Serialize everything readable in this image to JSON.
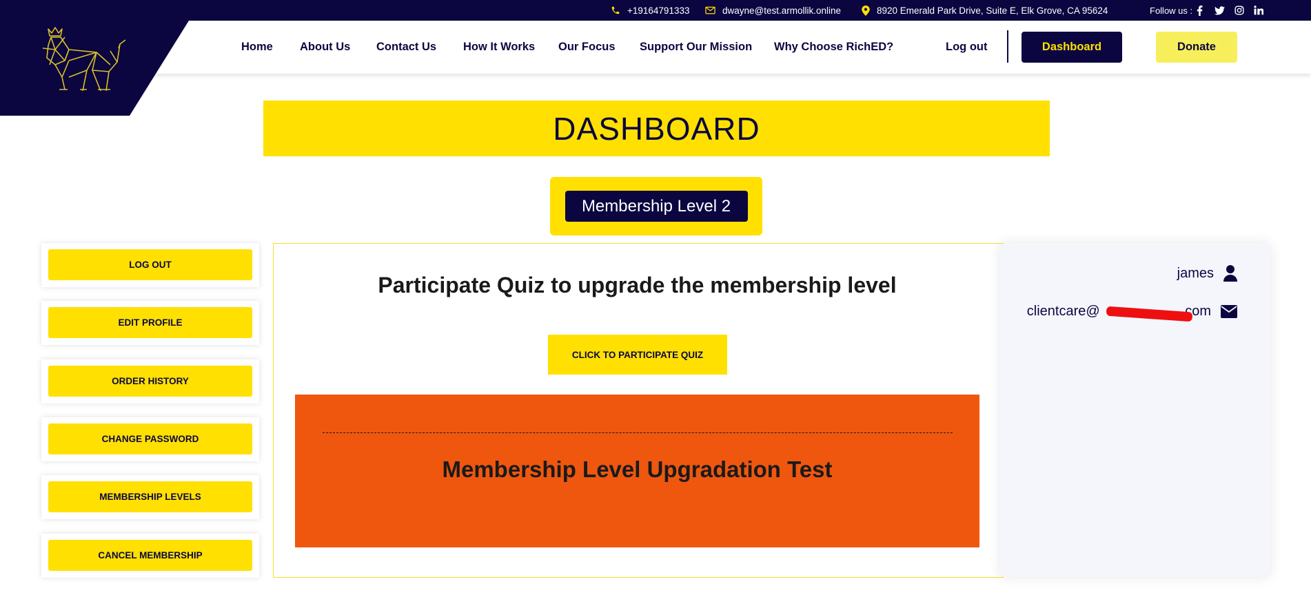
{
  "topbar": {
    "phone": "+19164791333",
    "email": "dwayne@test.armollik.online",
    "address": "8920 Emerald Park Drive, Suite E, Elk Grove, CA 95624",
    "follow_label": "Follow us :"
  },
  "nav": {
    "links": [
      "Home",
      "About Us",
      "Contact Us",
      "How It Works",
      "Our Focus",
      "Support Our Mission",
      "Why Choose RichED?",
      "Log out"
    ],
    "dashboard_label": "Dashboard",
    "donate_label": "Donate"
  },
  "page": {
    "title": "DASHBOARD",
    "membership_level": "Membership Level 2"
  },
  "sidebar": {
    "items": [
      "LOG OUT",
      "EDIT PROFILE",
      "ORDER HISTORY",
      "CHANGE PASSWORD",
      "MEMBERSHIP LEVELS",
      "CANCEL MEMBERSHIP"
    ]
  },
  "main": {
    "quiz_heading": "Participate Quiz to upgrade the membership level",
    "quiz_button": "CLICK TO PARTICIPATE QUIZ",
    "test_title": "Membership Level Upgradation Test"
  },
  "profile": {
    "username": "james",
    "email_prefix": "clientcare@",
    "email_suffix": ".com"
  },
  "colors": {
    "navy": "#0b0640",
    "yellow": "#ffe000",
    "donate_yellow": "#f6ef5b",
    "orange": "#ef570f",
    "redaction": "#ee1010"
  },
  "icons": [
    "phone-icon",
    "mail-icon",
    "location-icon",
    "facebook-icon",
    "twitter-icon",
    "instagram-icon",
    "linkedin-icon",
    "lion-logo",
    "user-icon",
    "envelope-icon"
  ]
}
